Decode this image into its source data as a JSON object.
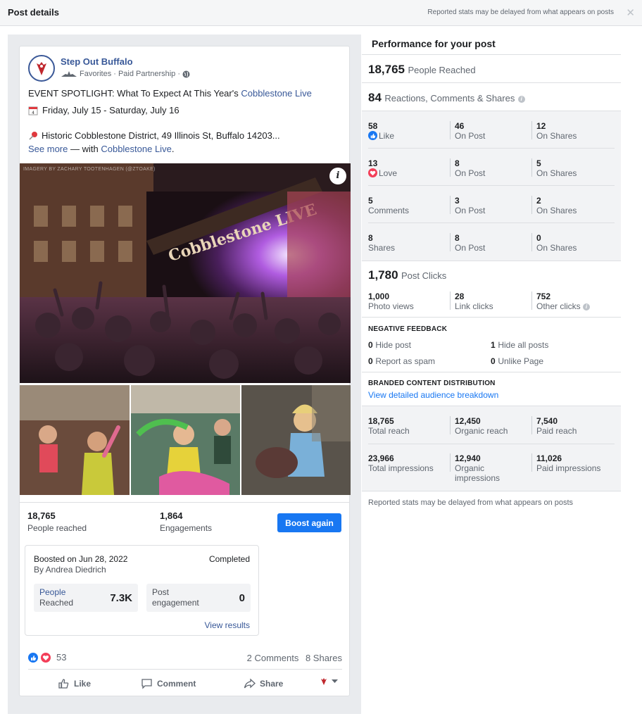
{
  "topbar": {
    "title": "Post details",
    "note": "Reported stats may be delayed from what appears on posts",
    "close_icon": "close-icon"
  },
  "post": {
    "page_name": "Step Out Buffalo",
    "favorites": "Favorites",
    "partnership": "· Paid Partnership ·",
    "headline": "EVENT SPOTLIGHT: What To Expect At This Year's ",
    "headline_link": "Cobblestone Live",
    "date_line": "Friday, July 15 - Saturday, July 16",
    "location_line": "Historic Cobblestone District, 49 Illinois St, Buffalo 14203...",
    "see_more": "See more",
    "with_text": " — with ",
    "with_link": "Cobblestone Live",
    "with_end": ".",
    "watermark": "IMAGERY BY ZACHARY TOOTENHAGEN (@ZTOAKE)",
    "photo_banner": "Cobblestone LIVE"
  },
  "summary": {
    "reached_value": "18,765",
    "reached_label": "People reached",
    "engagements_value": "1,864",
    "engagements_label": "Engagements",
    "boost_label": "Boost again"
  },
  "boost": {
    "boosted_on": "Boosted on Jun 28, 2022",
    "status": "Completed",
    "by": "By Andrea Diedrich",
    "people_label_1": "People",
    "people_label_2": "Reached",
    "people_value": "7.3K",
    "post_label_1": "Post",
    "post_label_2": "engagement",
    "post_value": "0",
    "view_results": "View results"
  },
  "reactions": {
    "count": "53",
    "comments": "2 Comments",
    "shares": "8 Shares"
  },
  "actions": {
    "like": "Like",
    "comment": "Comment",
    "share": "Share"
  },
  "performance": {
    "title": "Performance for your post",
    "people_reached_value": "18,765",
    "people_reached_label": "People Reached",
    "rcs_value": "84",
    "rcs_label": "Reactions, Comments & Shares",
    "rows": [
      {
        "value": "58",
        "label": "Like",
        "post_value": "46",
        "post_label": "On Post",
        "shares_value": "12",
        "shares_label": "On Shares"
      },
      {
        "value": "13",
        "label": "Love",
        "post_value": "8",
        "post_label": "On Post",
        "shares_value": "5",
        "shares_label": "On Shares"
      },
      {
        "value": "5",
        "label": "Comments",
        "post_value": "3",
        "post_label": "On Post",
        "shares_value": "2",
        "shares_label": "On Shares"
      },
      {
        "value": "8",
        "label": "Shares",
        "post_value": "8",
        "post_label": "On Post",
        "shares_value": "0",
        "shares_label": "On Shares"
      }
    ],
    "post_clicks_value": "1,780",
    "post_clicks_label": "Post Clicks",
    "clicks": [
      {
        "value": "1,000",
        "label": "Photo views"
      },
      {
        "value": "28",
        "label": "Link clicks"
      },
      {
        "value": "752",
        "label": "Other clicks"
      }
    ],
    "negative_title": "NEGATIVE FEEDBACK",
    "negative": [
      {
        "value": "0",
        "label": "Hide post"
      },
      {
        "value": "1",
        "label": "Hide all posts"
      },
      {
        "value": "0",
        "label": "Report as spam"
      },
      {
        "value": "0",
        "label": "Unlike Page"
      }
    ],
    "branded_title": "BRANDED CONTENT DISTRIBUTION",
    "branded_link": "View detailed audience breakdown",
    "reach": [
      {
        "value": "18,765",
        "label": "Total reach"
      },
      {
        "value": "12,450",
        "label": "Organic reach"
      },
      {
        "value": "7,540",
        "label": "Paid reach"
      }
    ],
    "impressions": [
      {
        "value": "23,966",
        "label": "Total impressions"
      },
      {
        "value": "12,940",
        "label_1": "Organic",
        "label_2": "impressions"
      },
      {
        "value": "11,026",
        "label": "Paid impressions"
      }
    ],
    "footer_note": "Reported stats may be delayed from what appears on posts"
  },
  "colors": {
    "link": "#385898",
    "accent": "#1877f2",
    "love": "#f33e58",
    "panel": "#e9ebee"
  }
}
